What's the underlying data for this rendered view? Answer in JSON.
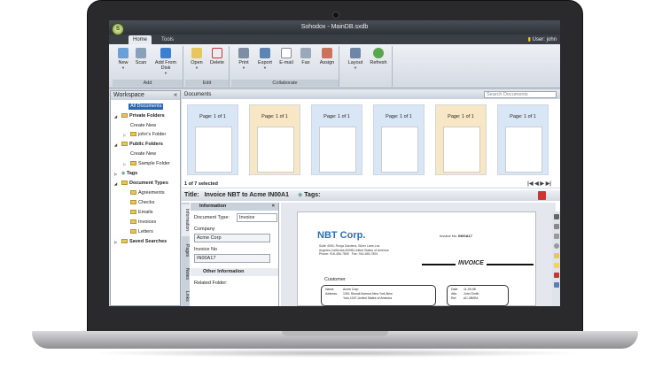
{
  "window": {
    "title": "Sohodox - MainDB.sxdb",
    "app_icon": "S"
  },
  "tabs": [
    {
      "label": "Home"
    },
    {
      "label": "Tools"
    }
  ],
  "user": {
    "label": "User: john"
  },
  "ribbon": {
    "add": {
      "label": "Add",
      "new": "New",
      "scan": "Scan",
      "add_from_disk": "Add From Disk"
    },
    "edit": {
      "label": "Edit",
      "open": "Open",
      "delete": "Delete"
    },
    "collaborate": {
      "label": "Collaborate",
      "print": "Print",
      "export": "Export",
      "email": "E-mail",
      "fax": "Fax",
      "assign": "Assign"
    },
    "layout": "Layout",
    "refresh": "Refresh"
  },
  "workspace": {
    "title": "Workspace",
    "collapse_icon": "«",
    "all_documents": "All Documents",
    "private_folders": "Private Folders",
    "create_new_1": "Create New",
    "johns_folder": "john's Folder",
    "public_folders": "Public Folders",
    "create_new_2": "Create New",
    "sample_folder": "Sample Folder",
    "tags": "Tags",
    "document_types": "Document Types",
    "types": [
      "Agreements",
      "Checks",
      "Emails",
      "Invoices",
      "Letters"
    ],
    "saved_searches": "Saved Searches"
  },
  "documents": {
    "title": "Documents",
    "search_placeholder": "Search Documents",
    "thumbs": [
      {
        "label": "Page: 1 of 1",
        "bg": "#d8e6f5"
      },
      {
        "label": "Page: 1 of 1",
        "bg": "#f8e7c4"
      },
      {
        "label": "Page: 1 of 1",
        "bg": "#d8e6f5"
      },
      {
        "label": "Page: 1 of 1",
        "bg": "#d8e6f5"
      },
      {
        "label": "Page: 1 of 1",
        "bg": "#f8e7c4"
      },
      {
        "label": "Page: 1 of 1",
        "bg": "#d8e6f5"
      }
    ],
    "selection": "1 of 7 selected"
  },
  "detail": {
    "title_label": "Title:",
    "title_value": "Invoice NBT to Acme IN00A1",
    "tags_label": "Tags:",
    "side_tabs": [
      "Information",
      "Pages",
      "Notes",
      "Links"
    ],
    "info_title": "Information",
    "document_type_label": "Document Type:",
    "document_type_value": "Invoice",
    "company_label": "Company",
    "company_value": "Acme Corp",
    "invoice_no_label": "Invoice No",
    "invoice_no_value": "IN00A17",
    "other_info": "Other Information",
    "related_folder": "Related Folder:"
  },
  "invoice_preview": {
    "company": "NBT Corp.",
    "address_line1": "Suite 4094, Ronja Gardens, Silver Lane,Los",
    "address_line2": "Angeles,California,90058,United States of America",
    "phone": "Phone: 916-456-7890",
    "fax": "Fax: 916-456-7891",
    "invoice_no_label": "Invoice No.",
    "invoice_no": "IN00A17",
    "heading": "INVOICE",
    "customer_label": "Customer",
    "name_label": "Name:",
    "name_value": "Acme Corp",
    "address_label": "Address:",
    "address_value1": "1301 Stonall Avenue,New York,New",
    "address_value2": "York,1007,United States of America",
    "date_label": "Date",
    "date_value": "11-09-98",
    "attn_label": "Attn:",
    "attn_value": "John Smith",
    "ref_label": "Ref",
    "ref_value": "AC-0B0B4"
  }
}
